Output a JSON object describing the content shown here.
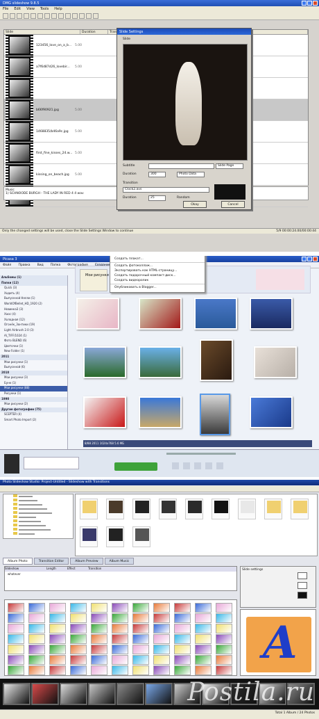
{
  "panel1": {
    "title": "DMG slideshow 9.8.5",
    "menu": [
      "File",
      "Edit",
      "View",
      "Tools",
      "Help"
    ],
    "columns": [
      "Slide",
      "Duration",
      "Transition",
      "Subtitle"
    ],
    "rows": [
      {
        "name": "123456_love_on_a_b...",
        "duration": "5.00",
        "sel": false
      },
      {
        "name": "a7f6d87d26_lovebir...",
        "duration": "5.00",
        "sel": false
      },
      {
        "name": "",
        "duration": "",
        "sel": false
      },
      {
        "name": "b66f90921.jpg",
        "duration": "5.00",
        "sel": true
      },
      {
        "name": "1468835/b46a9c.jpg",
        "duration": "5.00",
        "sel": false
      },
      {
        "name": "first_fine_kisses_24.w...",
        "duration": "5.00",
        "sel": false
      },
      {
        "name": "kissing_on_beach.jpg",
        "duration": "5.00",
        "sel": false
      },
      {
        "name": "hanani_in-4456b2.jpg",
        "duration": "5.00",
        "sel": false
      }
    ],
    "dialog": {
      "title": "Slide Settings",
      "slide_label": "Slide",
      "subtitle_label": "Subtitle",
      "subtitle_position": "Slide Page",
      "duration_label": "Duration",
      "duration_value": "300",
      "photo_data": "Photo Data",
      "transition_label": "Transition",
      "transition_value": "Clock2.avs",
      "tduration_label": "Duration",
      "tduration_value": "25",
      "random_label": "Random",
      "ok": "Okay",
      "cancel": "Cancel"
    },
    "notes_label": "Music",
    "notes_text": "1) SCHNOODE BURGH - THE LADY IN RED 4 4 wav",
    "status_left": "Only the changed settings will be used, close the Slide Settings Window to continue",
    "status_right": "5/9 00:00:24.00/00:00:44"
  },
  "panel2": {
    "title": "Picasa 3",
    "menu": [
      "Файл",
      "Правка",
      "Вид",
      "Папка",
      "Фотография",
      "Создание",
      "Инструменты",
      "Справка"
    ],
    "context_menu": [
      "Установить на рабочий стол...",
      "Создать плакат...",
      "Создать фотоколлаж...",
      "Экспортировать как HTML-страницу...",
      "Создать подарочный компакт-диск...",
      "Создать видеоролик",
      "Опубликовать в Blogger..."
    ],
    "sidebar": [
      {
        "t": "Альбомы (1)",
        "h": true
      },
      {
        "t": "Папки (12)",
        "h": true
      },
      {
        "t": "Quick (3)"
      },
      {
        "t": "Ходить (4)"
      },
      {
        "t": "Выпускной Нелли (1)"
      },
      {
        "t": "WorldOfBellet_HD_1920 (2)"
      },
      {
        "t": "Новинка3 (3)"
      },
      {
        "t": "Хаос (4)"
      },
      {
        "t": "Холодная (12)"
      },
      {
        "t": "Огонёк_Зонтики (19)"
      },
      {
        "t": "Light Airbrush 2.0 (3)"
      },
      {
        "t": "AI_TIFF/1024 (1)"
      },
      {
        "t": "Фото BLEND (6)"
      },
      {
        "t": "Цветочки (1)"
      },
      {
        "t": "New Folder (1)"
      },
      {
        "t": "2011",
        "h": true
      },
      {
        "t": "Мои рисунки (1)"
      },
      {
        "t": "Выпускной (6)"
      },
      {
        "t": "2010",
        "h": true
      },
      {
        "t": "Мои рисунки (3)"
      },
      {
        "t": "Бунк (1)"
      },
      {
        "t": "Мои рисунки (88)",
        "s": true
      },
      {
        "t": "Рисунки (1)"
      },
      {
        "t": "1990",
        "h": true
      },
      {
        "t": "Мои рисунки (2)"
      },
      {
        "t": "Другие фотографии (75)",
        "h": true
      },
      {
        "t": "SCEPTER (4)"
      },
      {
        "t": "Smart Photo Import (2)"
      }
    ],
    "folder_label": "Мои рисунки",
    "status": "8/88 2011 1024х768 5.6 МБ"
  },
  "panel3": {
    "title": "Photo Slideshow Studio: Project-Untitled - Slideshow with Transitions",
    "tabs": [
      "Album Photo",
      "Transition Editor",
      "Album Preview",
      "Album Music"
    ],
    "slides_header": [
      "Slideshow",
      "Length",
      "Effect",
      "Transition"
    ],
    "slide_name": "whatever",
    "options_header": "Slide settings",
    "preview_letter": "A",
    "status": "Total 1 Album / 24 Photos"
  },
  "watermark": "Postila.ru",
  "colors": {
    "xp_blue": "#2c5fd0",
    "selected": "#3b5ca8",
    "green": "#3ea23a",
    "preview_bg": "#f2a34a",
    "preview_letter": "#1f3ec8"
  }
}
